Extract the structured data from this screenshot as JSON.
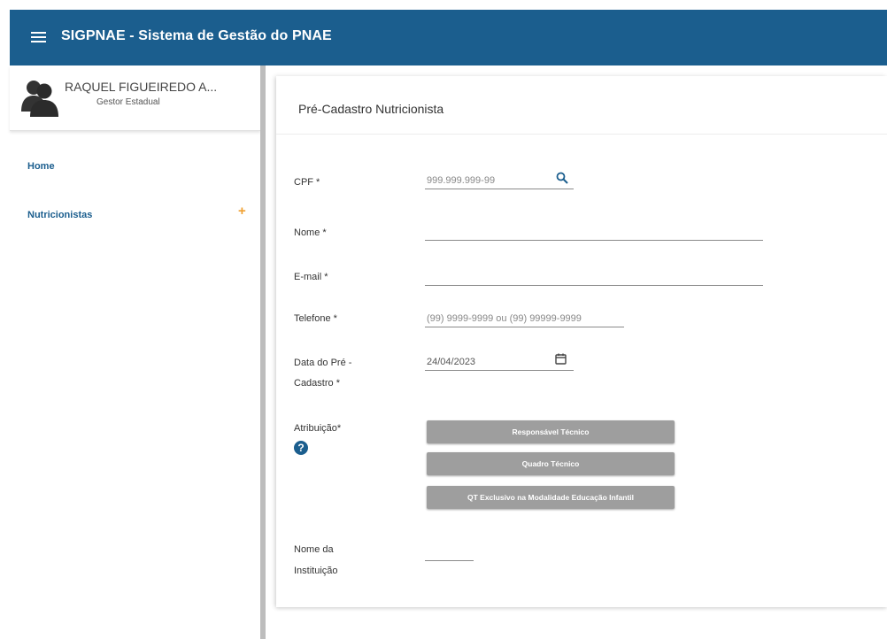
{
  "header": {
    "title": "SIGPNAE - Sistema de Gestão do PNAE",
    "menu_icon": "hamburger-menu-icon"
  },
  "user": {
    "name": "RAQUEL FIGUEIREDO A...",
    "role": "Gestor Estadual",
    "avatar_icon": "user-avatar-icon"
  },
  "sidebar": {
    "items": [
      {
        "label": "Home"
      },
      {
        "label": "Nutricionistas",
        "expand_symbol": "+"
      }
    ]
  },
  "form": {
    "title": "Pré-Cadastro Nutricionista",
    "cpf": {
      "label": "CPF *",
      "placeholder": "999.999.999-99"
    },
    "nome": {
      "label": "Nome *",
      "value": ""
    },
    "email": {
      "label": "E-mail *",
      "value": ""
    },
    "telefone": {
      "label": "Telefone *",
      "placeholder": "(99) 9999-9999 ou (99) 99999-9999"
    },
    "data": {
      "label_line1": "Data do Pré -",
      "label_line2": "Cadastro *",
      "value": "24/04/2023"
    },
    "atribuicao": {
      "label": "Atribuição*",
      "help_symbol": "?",
      "options": [
        "Responsável Técnico",
        "Quadro Técnico",
        "QT Exclusivo na Modalidade Educação Infantil"
      ]
    },
    "instituicao": {
      "label_line1": "Nome da",
      "label_line2": "Instituição",
      "value": ""
    }
  },
  "colors": {
    "primary": "#1b5e8e",
    "accent": "#f0a030",
    "button": "#9e9e9e"
  }
}
